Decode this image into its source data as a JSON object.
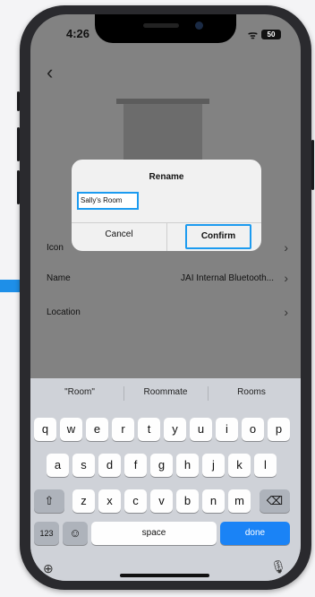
{
  "status_bar": {
    "time": "4:26",
    "wifi": "ᯤ",
    "battery": "50"
  },
  "header": {
    "back": "‹"
  },
  "rows": [
    {
      "label": "Icon",
      "value": "",
      "chevron": "›"
    },
    {
      "label": "Name",
      "value": "JAI Internal Bluetooth...",
      "chevron": "›"
    },
    {
      "label": "Location",
      "value": "",
      "chevron": "›"
    }
  ],
  "dialog": {
    "title": "Rename",
    "input_value": "Sally's Room",
    "cancel_label": "Cancel",
    "confirm_label": "Confirm"
  },
  "keyboard": {
    "suggestions": [
      "\"Room\"",
      "Roommate",
      "Rooms"
    ],
    "row1": [
      "q",
      "w",
      "e",
      "r",
      "t",
      "y",
      "u",
      "i",
      "o",
      "p"
    ],
    "row2": [
      "a",
      "s",
      "d",
      "f",
      "g",
      "h",
      "j",
      "k",
      "l"
    ],
    "row3": [
      "z",
      "x",
      "c",
      "v",
      "b",
      "n",
      "m"
    ],
    "shift": "⇧",
    "backspace": "⌫",
    "numbers": "123",
    "emoji": "☺",
    "space": "space",
    "done": "done",
    "globe": "⊕",
    "mic": "🎙"
  },
  "colors": {
    "highlight": "#1c9bf0",
    "done_key": "#1a83f6",
    "accent": "#1e8fe8"
  }
}
